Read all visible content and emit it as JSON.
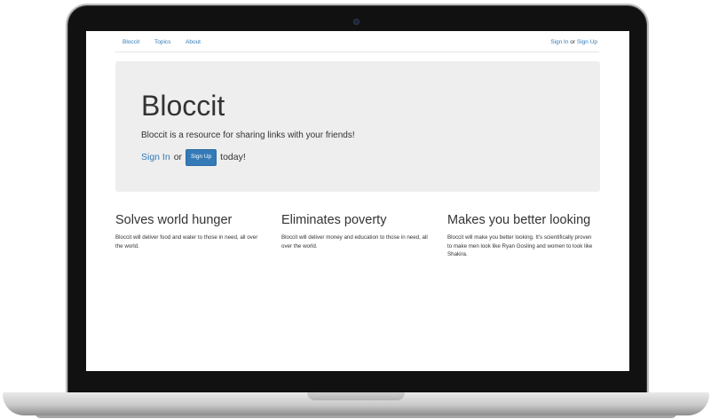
{
  "navbar": {
    "links": [
      "Bloccit",
      "Topics",
      "About"
    ],
    "sign_in": "Sign In",
    "or": "or",
    "sign_up": "Sign Up"
  },
  "jumbotron": {
    "title": "Bloccit",
    "lead": "Bloccit is a resource for sharing links with your friends!",
    "sign_in": "Sign In",
    "or": "or",
    "sign_up_button": "Sign Up",
    "today": "today!"
  },
  "features": [
    {
      "heading": "Solves world hunger",
      "text": "Bloccit will deliver food and water to those in need, all over the world."
    },
    {
      "heading": "Eliminates poverty",
      "text": "Bloccit will deliver money and education to those in need, all over the world."
    },
    {
      "heading": "Makes you better looking",
      "text": "Bloccit will make you better looking. It's scientifically proven to make men look like Ryan Gosling and women to look like Shakira."
    }
  ],
  "colors": {
    "link": "#337ab7",
    "jumbotron_bg": "#eeeeee",
    "text": "#333333",
    "bezel": "#111111"
  },
  "icons": [
    "camera-icon"
  ]
}
